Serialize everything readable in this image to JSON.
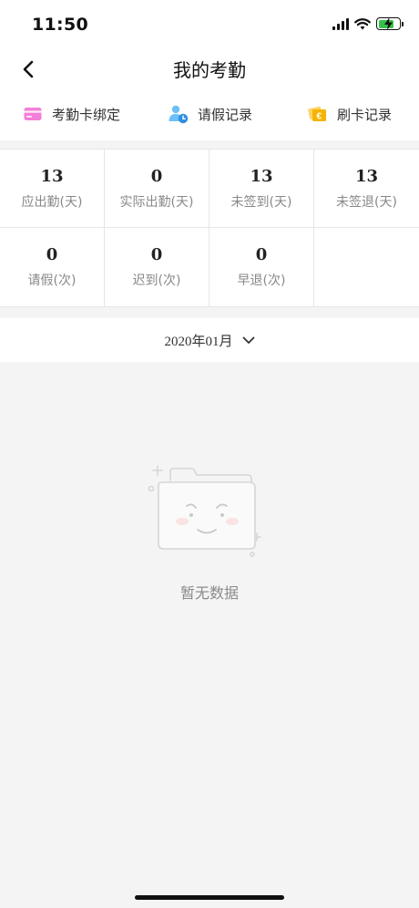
{
  "status_bar": {
    "time": "11:50",
    "icons": [
      "signal-icon",
      "wifi-icon",
      "battery-charging-icon"
    ],
    "battery_level": 0.75,
    "battery_color": "#36c24a"
  },
  "header": {
    "title": "我的考勤",
    "back_icon": "chevron-left-icon"
  },
  "quick_actions": [
    {
      "label": "考勤卡绑定",
      "icon": "card-icon",
      "color": "#f47fd8"
    },
    {
      "label": "请假记录",
      "icon": "user-clock-icon",
      "color": "#3fa9f5"
    },
    {
      "label": "刷卡记录",
      "icon": "ticket-icon",
      "color": "#f5b400"
    }
  ],
  "stats": [
    {
      "value": "13",
      "label": "应出勤(天)"
    },
    {
      "value": "0",
      "label": "实际出勤(天)"
    },
    {
      "value": "13",
      "label": "未签到(天)"
    },
    {
      "value": "13",
      "label": "未签退(天)"
    },
    {
      "value": "0",
      "label": "请假(次)"
    },
    {
      "value": "0",
      "label": "迟到(次)"
    },
    {
      "value": "0",
      "label": "早退(次)"
    }
  ],
  "month_selector": {
    "label": "2020年01月",
    "icon": "chevron-down-icon"
  },
  "empty_state": {
    "text": "暂无数据",
    "icon": "empty-folder-icon"
  }
}
